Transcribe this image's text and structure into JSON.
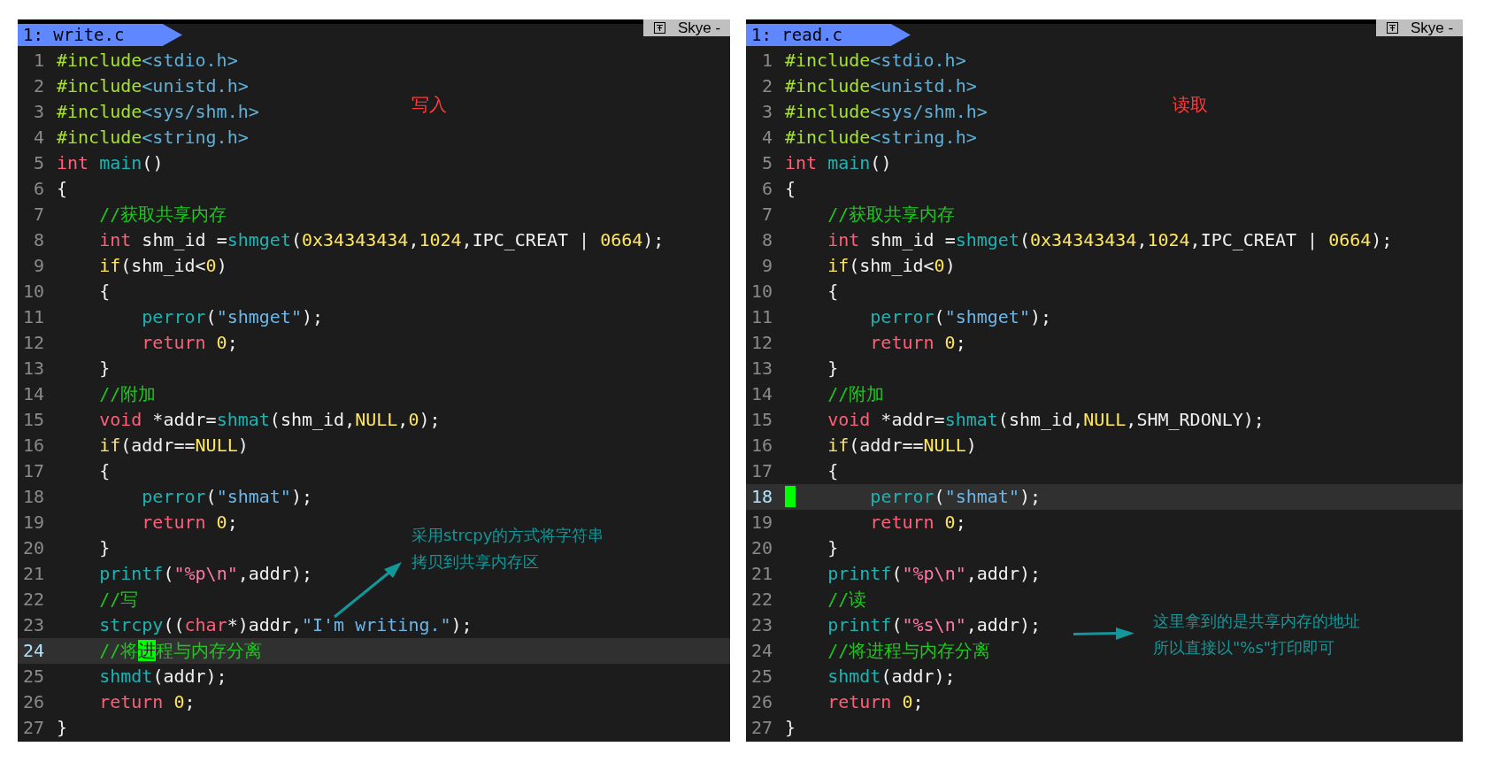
{
  "panes": [
    {
      "tab": "1: write.c",
      "corner_label": "Skye -",
      "title_note": "写入",
      "note_lines": [
        "采用strcpy的方式将字符串",
        "拷贝到共享内存区"
      ],
      "lines": [
        {
          "number": "1",
          "current": false,
          "tokens": [
            {
              "text": "#include",
              "kind": "pre"
            },
            {
              "text": "<stdio.h>",
              "kind": "hdr"
            }
          ]
        },
        {
          "number": "2",
          "current": false,
          "tokens": [
            {
              "text": "#include",
              "kind": "pre"
            },
            {
              "text": "<unistd.h>",
              "kind": "hdr"
            }
          ]
        },
        {
          "number": "3",
          "current": false,
          "tokens": [
            {
              "text": "#include",
              "kind": "pre"
            },
            {
              "text": "<sys/shm.h>",
              "kind": "hdr"
            }
          ]
        },
        {
          "number": "4",
          "current": false,
          "tokens": [
            {
              "text": "#include",
              "kind": "pre"
            },
            {
              "text": "<string.h>",
              "kind": "hdr"
            }
          ]
        },
        {
          "number": "5",
          "current": false,
          "tokens": [
            {
              "text": "int",
              "kind": "kw"
            },
            {
              "text": " main",
              "kind": "fn"
            },
            {
              "text": "()",
              "kind": "plain"
            }
          ]
        },
        {
          "number": "6",
          "current": false,
          "tokens": [
            {
              "text": "{",
              "kind": "plain"
            }
          ]
        },
        {
          "number": "7",
          "current": false,
          "tokens": [
            {
              "text": "    //获取共享内存",
              "kind": "cmt"
            }
          ]
        },
        {
          "number": "8",
          "current": false,
          "tokens": [
            {
              "text": "    int",
              "kind": "kw"
            },
            {
              "text": " shm_id =",
              "kind": "plain"
            },
            {
              "text": "shmget",
              "kind": "fn"
            },
            {
              "text": "(",
              "kind": "plain"
            },
            {
              "text": "0x34343434",
              "kind": "num"
            },
            {
              "text": ",",
              "kind": "plain"
            },
            {
              "text": "1024",
              "kind": "num"
            },
            {
              "text": ",IPC_CREAT | ",
              "kind": "plain"
            },
            {
              "text": "0664",
              "kind": "num"
            },
            {
              "text": ");",
              "kind": "plain"
            }
          ]
        },
        {
          "number": "9",
          "current": false,
          "tokens": [
            {
              "text": "    if",
              "kind": "ctrl"
            },
            {
              "text": "(shm_id<",
              "kind": "plain"
            },
            {
              "text": "0",
              "kind": "num"
            },
            {
              "text": ")",
              "kind": "plain"
            }
          ]
        },
        {
          "number": "10",
          "current": false,
          "tokens": [
            {
              "text": "    {",
              "kind": "plain"
            }
          ]
        },
        {
          "number": "11",
          "current": false,
          "tokens": [
            {
              "text": "        perror",
              "kind": "fn"
            },
            {
              "text": "(",
              "kind": "plain"
            },
            {
              "text": "\"shmget\"",
              "kind": "str"
            },
            {
              "text": ");",
              "kind": "plain"
            }
          ]
        },
        {
          "number": "12",
          "current": false,
          "tokens": [
            {
              "text": "        return",
              "kind": "kw"
            },
            {
              "text": " 0",
              "kind": "num"
            },
            {
              "text": ";",
              "kind": "plain"
            }
          ]
        },
        {
          "number": "13",
          "current": false,
          "tokens": [
            {
              "text": "    }",
              "kind": "plain"
            }
          ]
        },
        {
          "number": "14",
          "current": false,
          "tokens": [
            {
              "text": "    //附加",
              "kind": "cmt"
            }
          ]
        },
        {
          "number": "15",
          "current": false,
          "tokens": [
            {
              "text": "    void",
              "kind": "kw"
            },
            {
              "text": " *addr=",
              "kind": "plain"
            },
            {
              "text": "shmat",
              "kind": "fn"
            },
            {
              "text": "(shm_id,",
              "kind": "plain"
            },
            {
              "text": "NULL",
              "kind": "num"
            },
            {
              "text": ",",
              "kind": "plain"
            },
            {
              "text": "0",
              "kind": "num"
            },
            {
              "text": ");",
              "kind": "plain"
            }
          ]
        },
        {
          "number": "16",
          "current": false,
          "tokens": [
            {
              "text": "    if",
              "kind": "ctrl"
            },
            {
              "text": "(addr==",
              "kind": "plain"
            },
            {
              "text": "NULL",
              "kind": "num"
            },
            {
              "text": ")",
              "kind": "plain"
            }
          ]
        },
        {
          "number": "17",
          "current": false,
          "tokens": [
            {
              "text": "    {",
              "kind": "plain"
            }
          ]
        },
        {
          "number": "18",
          "current": false,
          "tokens": [
            {
              "text": "        perror",
              "kind": "fn"
            },
            {
              "text": "(",
              "kind": "plain"
            },
            {
              "text": "\"shmat\"",
              "kind": "str"
            },
            {
              "text": ");",
              "kind": "plain"
            }
          ]
        },
        {
          "number": "19",
          "current": false,
          "tokens": [
            {
              "text": "        return",
              "kind": "kw"
            },
            {
              "text": " 0",
              "kind": "num"
            },
            {
              "text": ";",
              "kind": "plain"
            }
          ]
        },
        {
          "number": "20",
          "current": false,
          "tokens": [
            {
              "text": "    }",
              "kind": "plain"
            }
          ]
        },
        {
          "number": "21",
          "current": false,
          "tokens": [
            {
              "text": "    printf",
              "kind": "fn"
            },
            {
              "text": "(",
              "kind": "plain"
            },
            {
              "text": "\"%p\\n\"",
              "kind": "fmt"
            },
            {
              "text": ",addr);",
              "kind": "plain"
            }
          ]
        },
        {
          "number": "22",
          "current": false,
          "tokens": [
            {
              "text": "    //写",
              "kind": "cmt"
            }
          ]
        },
        {
          "number": "23",
          "current": false,
          "tokens": [
            {
              "text": "    strcpy",
              "kind": "fn"
            },
            {
              "text": "((",
              "kind": "plain"
            },
            {
              "text": "char",
              "kind": "kw"
            },
            {
              "text": "*)addr,",
              "kind": "plain"
            },
            {
              "text": "\"I'm writing.\"",
              "kind": "str"
            },
            {
              "text": ");",
              "kind": "plain"
            }
          ]
        },
        {
          "number": "24",
          "current": true,
          "tokens": [
            {
              "text": "    //将",
              "kind": "cmt"
            },
            {
              "text": "进",
              "kind": "cursor"
            },
            {
              "text": "程与内存分离",
              "kind": "cmt"
            }
          ]
        },
        {
          "number": "25",
          "current": false,
          "tokens": [
            {
              "text": "    shmdt",
              "kind": "fn"
            },
            {
              "text": "(addr);",
              "kind": "plain"
            }
          ]
        },
        {
          "number": "26",
          "current": false,
          "tokens": [
            {
              "text": "    return",
              "kind": "kw"
            },
            {
              "text": " 0",
              "kind": "num"
            },
            {
              "text": ";",
              "kind": "plain"
            }
          ]
        },
        {
          "number": "27",
          "current": false,
          "tokens": [
            {
              "text": "}",
              "kind": "plain"
            }
          ]
        }
      ]
    },
    {
      "tab": "1: read.c",
      "corner_label": "Skye -",
      "title_note": "读取",
      "note_lines": [
        "这里拿到的是共享内存的地址",
        "所以直接以\"%s\"打印即可"
      ],
      "lines": [
        {
          "number": "1",
          "current": false,
          "tokens": [
            {
              "text": "#include",
              "kind": "pre"
            },
            {
              "text": "<stdio.h>",
              "kind": "hdr"
            }
          ]
        },
        {
          "number": "2",
          "current": false,
          "tokens": [
            {
              "text": "#include",
              "kind": "pre"
            },
            {
              "text": "<unistd.h>",
              "kind": "hdr"
            }
          ]
        },
        {
          "number": "3",
          "current": false,
          "tokens": [
            {
              "text": "#include",
              "kind": "pre"
            },
            {
              "text": "<sys/shm.h>",
              "kind": "hdr"
            }
          ]
        },
        {
          "number": "4",
          "current": false,
          "tokens": [
            {
              "text": "#include",
              "kind": "pre"
            },
            {
              "text": "<string.h>",
              "kind": "hdr"
            }
          ]
        },
        {
          "number": "5",
          "current": false,
          "tokens": [
            {
              "text": "int",
              "kind": "kw"
            },
            {
              "text": " main",
              "kind": "fn"
            },
            {
              "text": "()",
              "kind": "plain"
            }
          ]
        },
        {
          "number": "6",
          "current": false,
          "tokens": [
            {
              "text": "{",
              "kind": "plain"
            }
          ]
        },
        {
          "number": "7",
          "current": false,
          "tokens": [
            {
              "text": "    //获取共享内存",
              "kind": "cmt"
            }
          ]
        },
        {
          "number": "8",
          "current": false,
          "tokens": [
            {
              "text": "    int",
              "kind": "kw"
            },
            {
              "text": " shm_id =",
              "kind": "plain"
            },
            {
              "text": "shmget",
              "kind": "fn"
            },
            {
              "text": "(",
              "kind": "plain"
            },
            {
              "text": "0x34343434",
              "kind": "num"
            },
            {
              "text": ",",
              "kind": "plain"
            },
            {
              "text": "1024",
              "kind": "num"
            },
            {
              "text": ",IPC_CREAT | ",
              "kind": "plain"
            },
            {
              "text": "0664",
              "kind": "num"
            },
            {
              "text": ");",
              "kind": "plain"
            }
          ]
        },
        {
          "number": "9",
          "current": false,
          "tokens": [
            {
              "text": "    if",
              "kind": "ctrl"
            },
            {
              "text": "(shm_id<",
              "kind": "plain"
            },
            {
              "text": "0",
              "kind": "num"
            },
            {
              "text": ")",
              "kind": "plain"
            }
          ]
        },
        {
          "number": "10",
          "current": false,
          "tokens": [
            {
              "text": "    {",
              "kind": "plain"
            }
          ]
        },
        {
          "number": "11",
          "current": false,
          "tokens": [
            {
              "text": "        perror",
              "kind": "fn"
            },
            {
              "text": "(",
              "kind": "plain"
            },
            {
              "text": "\"shmget\"",
              "kind": "str"
            },
            {
              "text": ");",
              "kind": "plain"
            }
          ]
        },
        {
          "number": "12",
          "current": false,
          "tokens": [
            {
              "text": "        return",
              "kind": "kw"
            },
            {
              "text": " 0",
              "kind": "num"
            },
            {
              "text": ";",
              "kind": "plain"
            }
          ]
        },
        {
          "number": "13",
          "current": false,
          "tokens": [
            {
              "text": "    }",
              "kind": "plain"
            }
          ]
        },
        {
          "number": "14",
          "current": false,
          "tokens": [
            {
              "text": "    //附加",
              "kind": "cmt"
            }
          ]
        },
        {
          "number": "15",
          "current": false,
          "tokens": [
            {
              "text": "    void",
              "kind": "kw"
            },
            {
              "text": " *addr=",
              "kind": "plain"
            },
            {
              "text": "shmat",
              "kind": "fn"
            },
            {
              "text": "(shm_id,",
              "kind": "plain"
            },
            {
              "text": "NULL",
              "kind": "num"
            },
            {
              "text": ",SHM_RDONLY);",
              "kind": "plain"
            }
          ]
        },
        {
          "number": "16",
          "current": false,
          "tokens": [
            {
              "text": "    if",
              "kind": "ctrl"
            },
            {
              "text": "(addr==",
              "kind": "plain"
            },
            {
              "text": "NULL",
              "kind": "num"
            },
            {
              "text": ")",
              "kind": "plain"
            }
          ]
        },
        {
          "number": "17",
          "current": false,
          "tokens": [
            {
              "text": "    {",
              "kind": "plain"
            }
          ]
        },
        {
          "number": "18",
          "current": true,
          "tokens": [
            {
              "kind": "cursor"
            },
            {
              "text": "       perror",
              "kind": "fn"
            },
            {
              "text": "(",
              "kind": "plain"
            },
            {
              "text": "\"shmat\"",
              "kind": "str"
            },
            {
              "text": ");",
              "kind": "plain"
            }
          ]
        },
        {
          "number": "19",
          "current": false,
          "tokens": [
            {
              "text": "        return",
              "kind": "kw"
            },
            {
              "text": " 0",
              "kind": "num"
            },
            {
              "text": ";",
              "kind": "plain"
            }
          ]
        },
        {
          "number": "20",
          "current": false,
          "tokens": [
            {
              "text": "    }",
              "kind": "plain"
            }
          ]
        },
        {
          "number": "21",
          "current": false,
          "tokens": [
            {
              "text": "    printf",
              "kind": "fn"
            },
            {
              "text": "(",
              "kind": "plain"
            },
            {
              "text": "\"%p\\n\"",
              "kind": "fmt"
            },
            {
              "text": ",addr);",
              "kind": "plain"
            }
          ]
        },
        {
          "number": "22",
          "current": false,
          "tokens": [
            {
              "text": "    //读",
              "kind": "cmt"
            }
          ]
        },
        {
          "number": "23",
          "current": false,
          "tokens": [
            {
              "text": "    printf",
              "kind": "fn"
            },
            {
              "text": "(",
              "kind": "plain"
            },
            {
              "text": "\"%s\\n\"",
              "kind": "fmt"
            },
            {
              "text": ",addr);",
              "kind": "plain"
            }
          ]
        },
        {
          "number": "24",
          "current": false,
          "tokens": [
            {
              "text": "    //将进程与内存分离",
              "kind": "cmt"
            }
          ]
        },
        {
          "number": "25",
          "current": false,
          "tokens": [
            {
              "text": "    shmdt",
              "kind": "fn"
            },
            {
              "text": "(addr);",
              "kind": "plain"
            }
          ]
        },
        {
          "number": "26",
          "current": false,
          "tokens": [
            {
              "text": "    return",
              "kind": "kw"
            },
            {
              "text": " 0",
              "kind": "num"
            },
            {
              "text": ";",
              "kind": "plain"
            }
          ]
        },
        {
          "number": "27",
          "current": false,
          "tokens": [
            {
              "text": "}",
              "kind": "plain"
            }
          ]
        }
      ]
    }
  ]
}
